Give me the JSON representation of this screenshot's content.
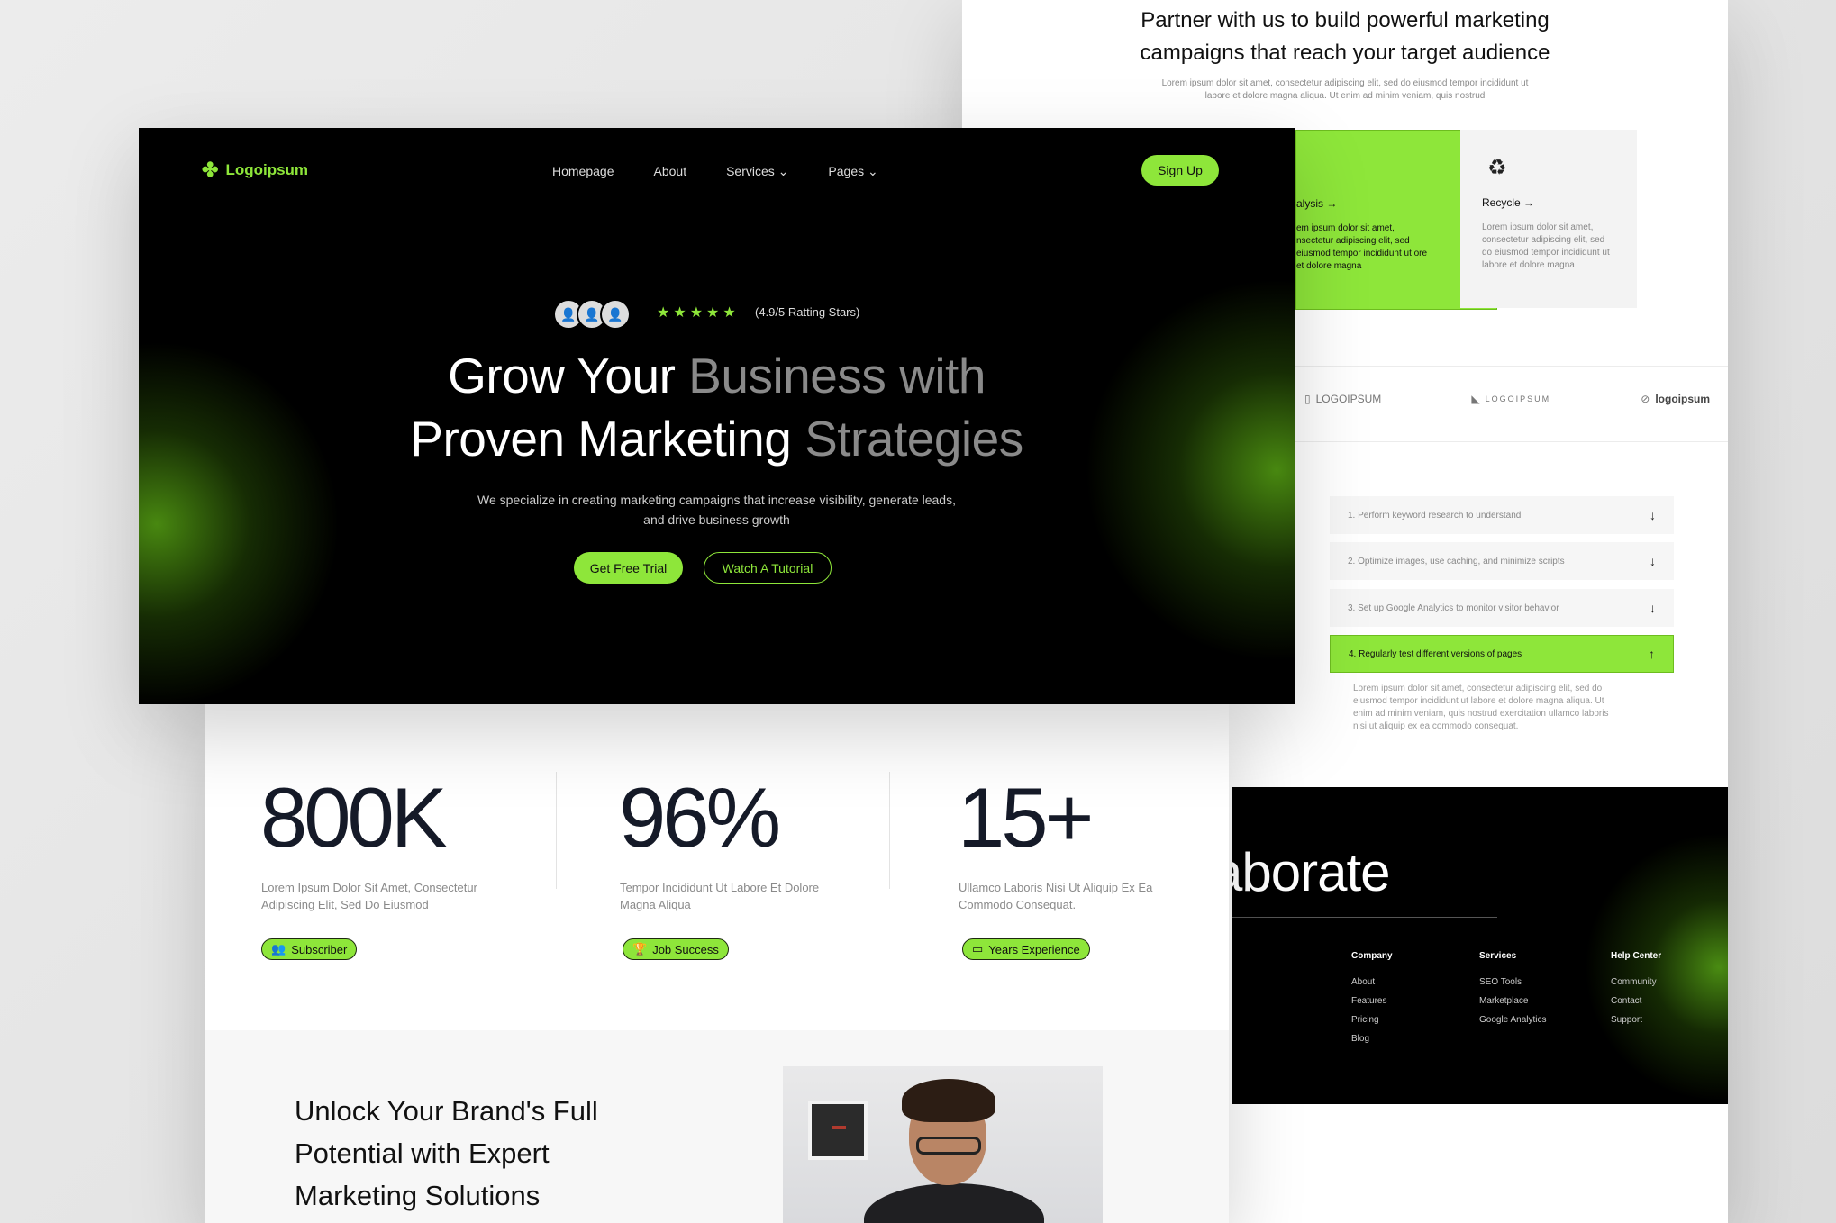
{
  "back": {
    "partner_line1": "Partner with us to build powerful marketing",
    "partner_line2": "campaigns that reach your target audience",
    "partner_sub": "Lorem ipsum dolor sit amet, consectetur adipiscing elit, sed do eiusmod tempor incididunt ut labore et dolore magna aliqua. Ut enim ad minim veniam, quis nostrud",
    "card_analysis": {
      "title": "alysis →",
      "text": "em ipsum dolor sit amet, nsectetur adipiscing elit, sed eiusmod tempor incididunt ut ore et dolore magna"
    },
    "card_recycle": {
      "icon": "recycle-icon",
      "title": "Recycle →",
      "text": "Lorem ipsum dolor sit amet, consectetur adipiscing elit, sed do eiusmod tempor incididunt ut labore et dolore magna"
    },
    "logos": [
      "LOGOIPSUM",
      "LOGOIPSUM",
      "logoipsum"
    ],
    "faq": [
      {
        "label": "1. Perform keyword research to understand",
        "arrow": "↓"
      },
      {
        "label": "2. Optimize images, use caching, and minimize scripts",
        "arrow": "↓"
      },
      {
        "label": "3. Set up Google Analytics to monitor visitor behavior",
        "arrow": "↓"
      },
      {
        "label": "4. Regularly test different versions of pages",
        "arrow": "↑"
      }
    ],
    "faq_answer": "Lorem ipsum dolor sit amet, consectetur adipiscing elit, sed do eiusmod tempor incididunt ut labore et dolore magna aliqua. Ut enim ad minim veniam, quis nostrud exercitation ullamco laboris nisi ut aliquip ex ea commodo consequat.",
    "footer": {
      "collab": "aborate",
      "company": {
        "heading": "Company",
        "items": [
          "About",
          "Features",
          "Pricing",
          "Blog"
        ]
      },
      "services": {
        "heading": "Services",
        "items": [
          "SEO Tools",
          "Marketplace",
          "Google Analytics"
        ]
      },
      "help": {
        "heading": "Help Center",
        "items": [
          "Community",
          "Contact",
          "Support"
        ]
      }
    }
  },
  "hero": {
    "logo_text": "Logoipsum",
    "nav": {
      "home": "Homepage",
      "about": "About",
      "services": "Services",
      "pages": "Pages"
    },
    "signup": "Sign Up",
    "stars": "★★★★★",
    "rating": "(4.9/5 Ratting Stars)",
    "headline_line1_a": "Grow Your ",
    "headline_line1_b": "Business with",
    "headline_line2_a": "Proven Marketing ",
    "headline_line2_b": "Strategies",
    "subtitle": "We specialize in creating marketing campaigns that increase visibility, generate leads, and drive business growth",
    "btn_trial": "Get Free Trial",
    "btn_tutorial": "Watch A Tutorial"
  },
  "stats": [
    {
      "value": "800K",
      "text": "Lorem Ipsum Dolor Sit Amet, Consectetur Adipiscing Elit, Sed Do Eiusmod",
      "badge": "Subscriber",
      "icon": "users-icon"
    },
    {
      "value": "96%",
      "text": "Tempor Incididunt Ut Labore Et Dolore Magna Aliqua",
      "badge": "Job Success",
      "icon": "trophy-icon"
    },
    {
      "value": "15+",
      "text": "Ullamco Laboris Nisi Ut Aliquip Ex Ea Commodo Consequat.",
      "badge": "Years Experience",
      "icon": "monitor-icon"
    }
  ],
  "lower": {
    "heading_l1": "Unlock Your Brand's Full",
    "heading_l2": "Potential with Expert",
    "heading_l3": "Marketing Solutions"
  },
  "colors": {
    "accent": "#8ee63a",
    "dark": "#000000",
    "text_dark": "#151a28"
  }
}
